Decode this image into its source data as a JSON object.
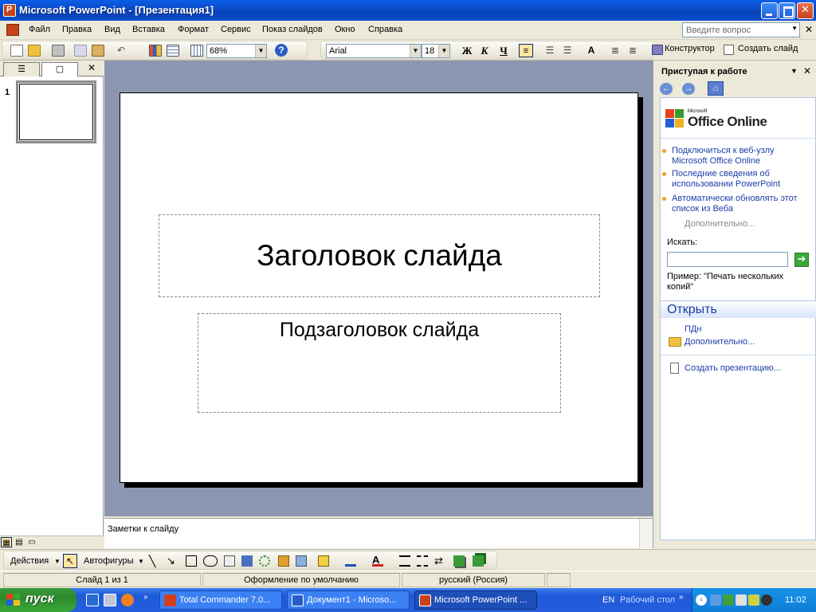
{
  "window": {
    "title": "Microsoft PowerPoint - [Презентация1]"
  },
  "menu": {
    "items": [
      "Файл",
      "Правка",
      "Вид",
      "Вставка",
      "Формат",
      "Сервис",
      "Показ слайдов",
      "Окно",
      "Справка"
    ],
    "help_placeholder": "Введите вопрос"
  },
  "toolbar": {
    "zoom": "68%",
    "font_name": "Arial",
    "font_size": "18",
    "bold": "Ж",
    "italic": "К",
    "underline": "Ч",
    "design_label": "Конструктор",
    "new_slide_label": "Создать слайд"
  },
  "slides_pane": {
    "slide_number": "1"
  },
  "slide": {
    "title": "Заголовок слайда",
    "subtitle": "Подзаголовок слайда"
  },
  "notes": {
    "placeholder": "Заметки к слайду"
  },
  "task_pane": {
    "title": "Приступая к работе",
    "logo_ms": "Microsoft",
    "logo_text": "Office Online",
    "links": [
      "Подключиться к веб-узлу Microsoft Office Online",
      "Последние сведения об использовании PowerPoint",
      "Автоматически обновлять этот список из Веба"
    ],
    "more_label": "Дополнительно...",
    "search_label": "Искать:",
    "example": "Пример:  \"Печать нескольких копий\"",
    "open_section": "Открыть",
    "recent_file": "ПДн",
    "open_more": "Дополнительно...",
    "create_label": "Создать презентацию..."
  },
  "drawing_toolbar": {
    "actions_label": "Действия",
    "autoshapes_label": "Автофигуры"
  },
  "status": {
    "slide": "Слайд 1 из 1",
    "design": "Оформление по умолчанию",
    "language": "русский (Россия)"
  },
  "taskbar": {
    "start_label": "пуск",
    "items": [
      "Total Commander 7.0...",
      "Документ1 - Microso...",
      "Microsoft PowerPoint ..."
    ],
    "lang": "EN",
    "desktop_label": "Рабочий стол",
    "time": "11:02"
  },
  "colors": {
    "title_bar": "#0a5ee8",
    "workspace": "#8c96b0",
    "link": "#1a3ea8",
    "taskbar": "#245edc",
    "start": "#3aa83a"
  }
}
